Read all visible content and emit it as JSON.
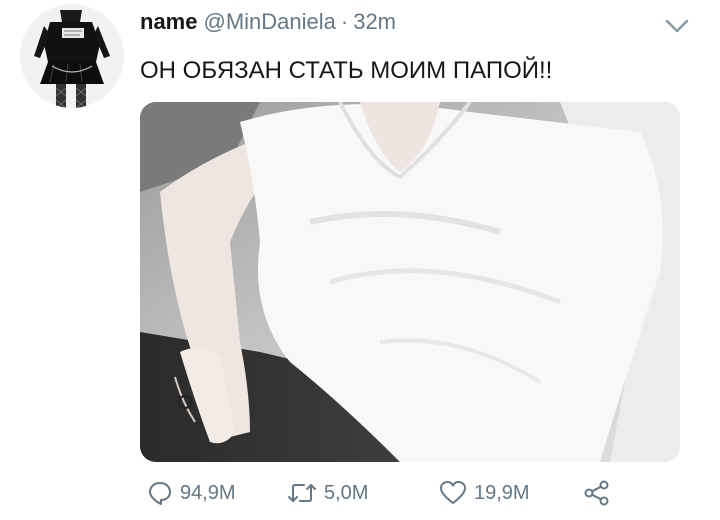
{
  "tweet": {
    "display_name": "name",
    "handle": "@MinDaniela",
    "separator": "·",
    "time": "32m",
    "text": "ОН ОБЯЗАН СТАТЬ МОИМ ПАПОЙ!!"
  },
  "actions": {
    "replies": "94,9M",
    "retweets": "5,0M",
    "likes": "19,9M"
  },
  "icons": {
    "more": "chevron-down-icon",
    "reply": "reply-icon",
    "retweet": "retweet-icon",
    "like": "heart-icon",
    "share": "share-icon"
  },
  "colors": {
    "text": "#14171a",
    "secondary": "#657786"
  }
}
